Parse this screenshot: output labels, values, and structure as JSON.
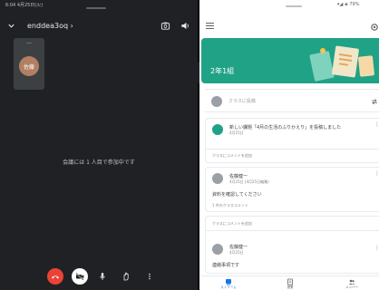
{
  "meet": {
    "status_bar": "6:04 4月25日(火)",
    "meeting_code": "enddea3oq",
    "participant_initials": "佐藤",
    "tile_menu": "...",
    "alone_message": "会議には 1 人目で参加中です",
    "icons": [
      "chevron-down-icon",
      "camera-switch-icon",
      "speaker-icon",
      "end-call-icon",
      "camera-off-icon",
      "mic-icon",
      "raise-hand-icon",
      "more-vert-icon"
    ],
    "end_call_color": "#ea4335"
  },
  "classroom": {
    "status_bar": "▾◢ ◈ 79%",
    "class_name": "2年1組",
    "banner_color": "#20a287",
    "post_placeholder": "クラスに投稿",
    "assignment": {
      "title": "新しい課題「4月の生活のふりかえり」を投稿しました",
      "date": "4月25日"
    },
    "comment_prompt_1": "クラスにコメントを追加",
    "post1": {
      "author": "佐藤健一",
      "time": "4月25日 (4月25日編集)",
      "text": "資料を確認してください",
      "comment": "1 件のクラスコメント"
    },
    "comment_prompt_2": "クラスにコメントを追加",
    "post2": {
      "author": "佐藤健一",
      "time": "4月25日",
      "text": "連絡事項です"
    },
    "nav": [
      {
        "label": "ストリーム"
      },
      {
        "label": "授業"
      },
      {
        "label": "メンバー"
      }
    ]
  }
}
